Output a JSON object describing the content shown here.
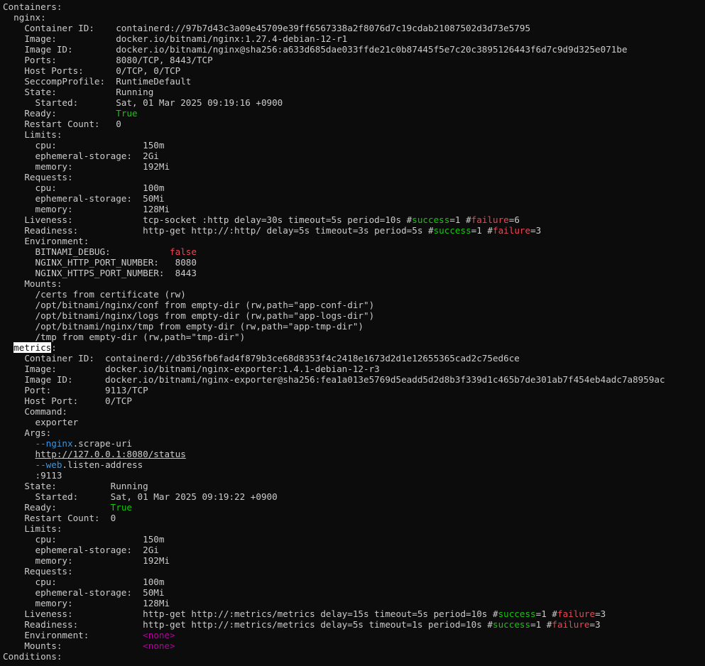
{
  "colors": {
    "background": "#0c0c0c",
    "foreground": "#cccccc",
    "green": "#16c60c",
    "red": "#e74856",
    "cyan": "#3a96dd",
    "magenta": "#b4009e",
    "highlight_bg": "#ffffff"
  },
  "lines": [
    {
      "segs": [
        {
          "t": "Containers:"
        }
      ]
    },
    {
      "segs": [
        {
          "t": "  nginx:"
        }
      ]
    },
    {
      "segs": [
        {
          "t": "    Container ID:    containerd://97b7d43c3a09e45709e39ff6567338a2f8076d7c19cdab21087502d3d73e5795"
        }
      ]
    },
    {
      "segs": [
        {
          "t": "    Image:           docker.io/bitnami/nginx:1.27.4-debian-12-r1"
        }
      ]
    },
    {
      "segs": [
        {
          "t": "    Image ID:        docker.io/bitnami/nginx@sha256:a633d685dae033ffde21c0b87445f5e7c20c3895126443f6d7c9d9d325e071be"
        }
      ]
    },
    {
      "segs": [
        {
          "t": "    Ports:           8080/TCP, 8443/TCP"
        }
      ]
    },
    {
      "segs": [
        {
          "t": "    Host Ports:      0/TCP, 0/TCP"
        }
      ]
    },
    {
      "segs": [
        {
          "t": "    SeccompProfile:  RuntimeDefault"
        }
      ]
    },
    {
      "segs": [
        {
          "t": "    State:           Running"
        }
      ]
    },
    {
      "segs": [
        {
          "t": "      Started:       Sat, 01 Mar 2025 09:19:16 +0900"
        }
      ]
    },
    {
      "segs": [
        {
          "t": "    Ready:           "
        },
        {
          "t": "True",
          "c": "ok"
        }
      ]
    },
    {
      "segs": [
        {
          "t": "    Restart Count:   0"
        }
      ]
    },
    {
      "segs": [
        {
          "t": "    Limits:"
        }
      ]
    },
    {
      "segs": [
        {
          "t": "      cpu:                150m"
        }
      ]
    },
    {
      "segs": [
        {
          "t": "      ephemeral-storage:  2Gi"
        }
      ]
    },
    {
      "segs": [
        {
          "t": "      memory:             192Mi"
        }
      ]
    },
    {
      "segs": [
        {
          "t": "    Requests:"
        }
      ]
    },
    {
      "segs": [
        {
          "t": "      cpu:                100m"
        }
      ]
    },
    {
      "segs": [
        {
          "t": "      ephemeral-storage:  50Mi"
        }
      ]
    },
    {
      "segs": [
        {
          "t": "      memory:             128Mi"
        }
      ]
    },
    {
      "segs": [
        {
          "t": "    Liveness:             tcp-socket :http delay=30s timeout=5s period=10s #"
        },
        {
          "t": "success",
          "c": "ok"
        },
        {
          "t": "=1 #"
        },
        {
          "t": "failure",
          "c": "bad"
        },
        {
          "t": "=6"
        }
      ]
    },
    {
      "segs": [
        {
          "t": "    Readiness:            http-get http://:http/ delay=5s timeout=3s period=5s #"
        },
        {
          "t": "success",
          "c": "ok"
        },
        {
          "t": "=1 #"
        },
        {
          "t": "failure",
          "c": "bad"
        },
        {
          "t": "=3"
        }
      ]
    },
    {
      "segs": [
        {
          "t": "    Environment:"
        }
      ]
    },
    {
      "segs": [
        {
          "t": "      BITNAMI_DEBUG:           "
        },
        {
          "t": "false",
          "c": "bad"
        }
      ]
    },
    {
      "segs": [
        {
          "t": "      NGINX_HTTP_PORT_NUMBER:   8080"
        }
      ]
    },
    {
      "segs": [
        {
          "t": "      NGINX_HTTPS_PORT_NUMBER:  8443"
        }
      ]
    },
    {
      "segs": [
        {
          "t": "    Mounts:"
        }
      ]
    },
    {
      "segs": [
        {
          "t": "      /certs from certificate (rw)"
        }
      ]
    },
    {
      "segs": [
        {
          "t": "      /opt/bitnami/nginx/conf from empty-dir (rw,path=\"app-conf-dir\")"
        }
      ]
    },
    {
      "segs": [
        {
          "t": "      /opt/bitnami/nginx/logs from empty-dir (rw,path=\"app-logs-dir\")"
        }
      ]
    },
    {
      "segs": [
        {
          "t": "      /opt/bitnami/nginx/tmp from empty-dir (rw,path=\"app-tmp-dir\")"
        }
      ]
    },
    {
      "segs": [
        {
          "t": "      /tmp from empty-dir (rw,path=\"tmp-dir\")"
        }
      ]
    },
    {
      "segs": [
        {
          "t": "  "
        },
        {
          "t": "metrics",
          "c": "hl"
        },
        {
          "t": ":"
        }
      ]
    },
    {
      "segs": [
        {
          "t": "    Container ID:  containerd://db356fb6fad4f879b3ce68d8353f4c2418e1673d2d1e12655365cad2c75ed6ce"
        }
      ]
    },
    {
      "segs": [
        {
          "t": "    Image:         docker.io/bitnami/nginx-exporter:1.4.1-debian-12-r3"
        }
      ]
    },
    {
      "segs": [
        {
          "t": "    Image ID:      docker.io/bitnami/nginx-exporter@sha256:fea1a013e5769d5eadd5d2d8b3f339d1c465b7de301ab7f454eb4adc7a8959ac"
        }
      ]
    },
    {
      "segs": [
        {
          "t": "    Port:          9113/TCP"
        }
      ]
    },
    {
      "segs": [
        {
          "t": "    Host Port:     0/TCP"
        }
      ]
    },
    {
      "segs": [
        {
          "t": "    Command:"
        }
      ]
    },
    {
      "segs": [
        {
          "t": "      exporter"
        }
      ]
    },
    {
      "segs": [
        {
          "t": "    Args:"
        }
      ]
    },
    {
      "segs": [
        {
          "t": "      "
        },
        {
          "t": "--nginx",
          "c": "cy"
        },
        {
          "t": ".scrape-uri"
        }
      ]
    },
    {
      "segs": [
        {
          "t": "      "
        },
        {
          "t": "http://127.0.0.1:8080/status",
          "c": "ul"
        }
      ]
    },
    {
      "segs": [
        {
          "t": "      "
        },
        {
          "t": "--web",
          "c": "cy"
        },
        {
          "t": ".listen-address"
        }
      ]
    },
    {
      "segs": [
        {
          "t": "      :9113"
        }
      ]
    },
    {
      "segs": [
        {
          "t": "    State:          Running"
        }
      ]
    },
    {
      "segs": [
        {
          "t": "      Started:      Sat, 01 Mar 2025 09:19:22 +0900"
        }
      ]
    },
    {
      "segs": [
        {
          "t": "    Ready:          "
        },
        {
          "t": "True",
          "c": "ok"
        }
      ]
    },
    {
      "segs": [
        {
          "t": "    Restart Count:  0"
        }
      ]
    },
    {
      "segs": [
        {
          "t": "    Limits:"
        }
      ]
    },
    {
      "segs": [
        {
          "t": "      cpu:                150m"
        }
      ]
    },
    {
      "segs": [
        {
          "t": "      ephemeral-storage:  2Gi"
        }
      ]
    },
    {
      "segs": [
        {
          "t": "      memory:             192Mi"
        }
      ]
    },
    {
      "segs": [
        {
          "t": "    Requests:"
        }
      ]
    },
    {
      "segs": [
        {
          "t": "      cpu:                100m"
        }
      ]
    },
    {
      "segs": [
        {
          "t": "      ephemeral-storage:  50Mi"
        }
      ]
    },
    {
      "segs": [
        {
          "t": "      memory:             128Mi"
        }
      ]
    },
    {
      "segs": [
        {
          "t": "    Liveness:             http-get http://:metrics/metrics delay=15s timeout=5s period=10s #"
        },
        {
          "t": "success",
          "c": "ok"
        },
        {
          "t": "=1 #"
        },
        {
          "t": "failure",
          "c": "bad"
        },
        {
          "t": "=3"
        }
      ]
    },
    {
      "segs": [
        {
          "t": "    Readiness:            http-get http://:metrics/metrics delay=5s timeout=1s period=10s #"
        },
        {
          "t": "success",
          "c": "ok"
        },
        {
          "t": "=1 #"
        },
        {
          "t": "failure",
          "c": "bad"
        },
        {
          "t": "=3"
        }
      ]
    },
    {
      "segs": [
        {
          "t": "    Environment:          "
        },
        {
          "t": "<none>",
          "c": "mg"
        }
      ]
    },
    {
      "segs": [
        {
          "t": "    Mounts:               "
        },
        {
          "t": "<none>",
          "c": "mg"
        }
      ]
    },
    {
      "segs": [
        {
          "t": "Conditions:"
        }
      ]
    }
  ]
}
